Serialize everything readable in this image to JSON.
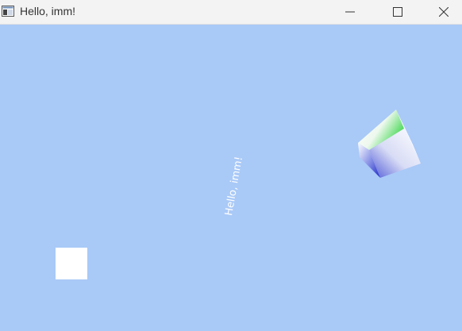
{
  "window": {
    "title": "Hello, imm!",
    "controls": {
      "minimize_icon": "minimize-icon",
      "maximize_icon": "maximize-icon",
      "close_icon": "close-icon"
    }
  },
  "scene": {
    "background_color": "#a9c9f7",
    "rotated_text": "Hello, imm!",
    "square_color": "#ffffff",
    "cube_colors": [
      "#ffffff",
      "#2f3bd0",
      "#3fdc4a"
    ]
  }
}
